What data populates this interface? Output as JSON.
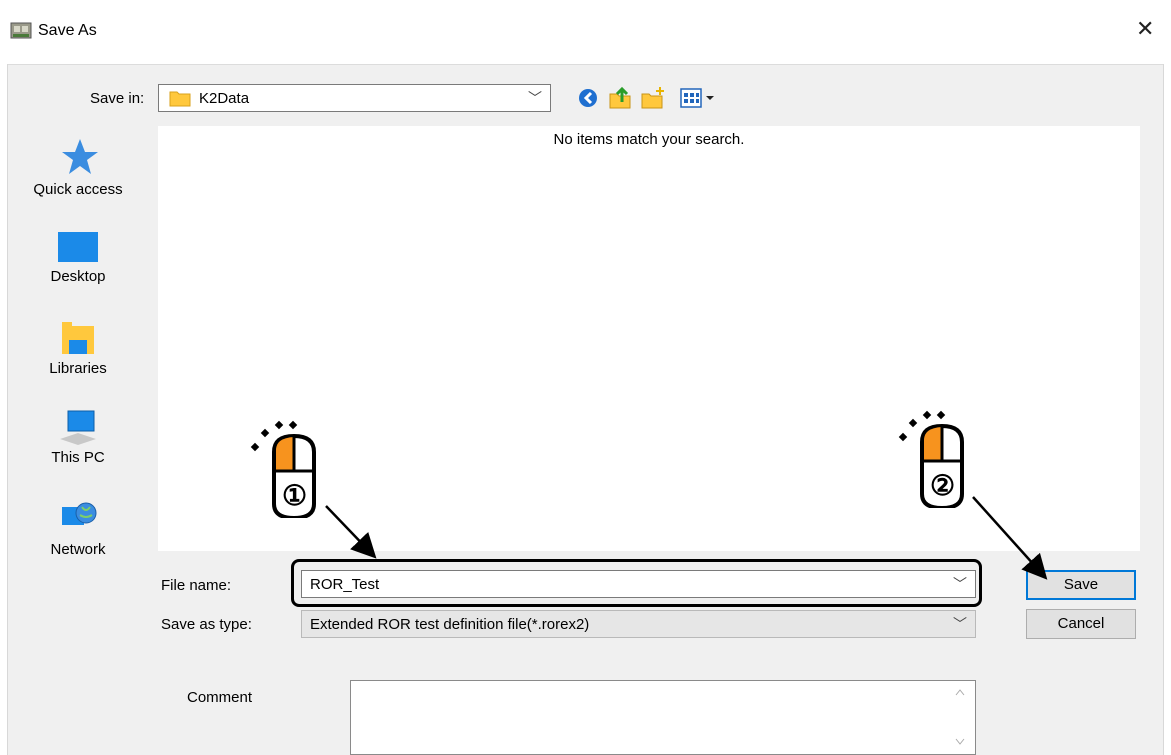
{
  "window": {
    "title": "Save As",
    "close_glyph": "✕"
  },
  "save_in": {
    "label": "Save in:",
    "value": "K2Data"
  },
  "toolbar_icons": [
    "back-icon",
    "up-folder-icon",
    "new-folder-icon",
    "view-menu-icon"
  ],
  "places": [
    {
      "label": "Quick access",
      "icon": "quick-access-star-icon"
    },
    {
      "label": "Desktop",
      "icon": "desktop-icon"
    },
    {
      "label": "Libraries",
      "icon": "libraries-icon"
    },
    {
      "label": "This PC",
      "icon": "this-pc-icon"
    },
    {
      "label": "Network",
      "icon": "network-icon"
    }
  ],
  "file_list": {
    "empty_message": "No items match your search."
  },
  "file_name": {
    "label": "File name:",
    "value": "ROR_Test"
  },
  "save_as_type": {
    "label": "Save as type:",
    "value": "Extended ROR test definition file(*.rorex2)"
  },
  "buttons": {
    "save": "Save",
    "cancel": "Cancel"
  },
  "comment": {
    "label": "Comment",
    "value": ""
  },
  "annotations": {
    "step1": "①",
    "step2": "②"
  },
  "colors": {
    "accent": "#0078d7",
    "mouse_button": "#f7931e",
    "folder": "#ffc83d"
  }
}
